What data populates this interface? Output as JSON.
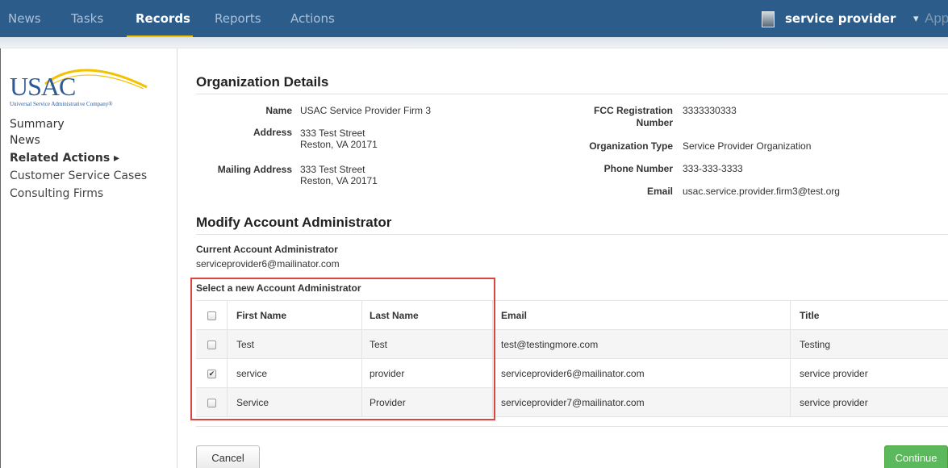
{
  "nav": {
    "items": [
      "News",
      "Tasks",
      "Records",
      "Reports",
      "Actions"
    ],
    "active": "Records",
    "user_name": "service provider",
    "user_caret": "▾",
    "apps_label": "App"
  },
  "colors": {
    "nav_bg": "#2c5d8a",
    "accent": "#f2c200",
    "highlight": "#d9463f",
    "continue_bg": "#5cb85c"
  },
  "logo": {
    "text": "USAC",
    "tagline": "Universal Service Administrative Company®"
  },
  "sidebar": {
    "links": [
      "Summary",
      "News",
      "Related Actions ▸",
      "Customer Service Cases",
      "Consulting Firms"
    ]
  },
  "org": {
    "title": "Organization Details",
    "name_label": "Name",
    "name": "USAC Service Provider Firm 3",
    "address_label": "Address",
    "address_line1": "333 Test Street",
    "address_line2": "Reston, VA 20171",
    "mailing_label": "Mailing Address",
    "mailing_line1": "333 Test Street",
    "mailing_line2": "Reston, VA 20171",
    "fcc_label_line1": "FCC Registration",
    "fcc_label_line2": "Number",
    "fcc": "3333330333",
    "org_type_label": "Organization Type",
    "org_type": "Service Provider Organization",
    "phone_label": "Phone Number",
    "phone": "333-333-3333",
    "email_label": "Email",
    "email": "usac.service.provider.firm3@test.org"
  },
  "admin": {
    "title": "Modify Account Administrator",
    "current_label": "Current Account Administrator",
    "current_value": "serviceprovider6@mailinator.com",
    "select_label": "Select a new Account Administrator",
    "columns": [
      "First Name",
      "Last Name",
      "Email",
      "Title"
    ],
    "rows": [
      {
        "first": "Test",
        "last": "Test",
        "email": "test@testingmore.com",
        "title": "Testing",
        "checked": ""
      },
      {
        "first": "service",
        "last": "provider",
        "email": "serviceprovider6@mailinator.com",
        "title": "service provider",
        "checked": "✔"
      },
      {
        "first": "Service",
        "last": "Provider",
        "email": "serviceprovider7@mailinator.com",
        "title": "service provider",
        "checked": ""
      }
    ]
  },
  "buttons": {
    "cancel": "Cancel",
    "continue": "Continue"
  }
}
